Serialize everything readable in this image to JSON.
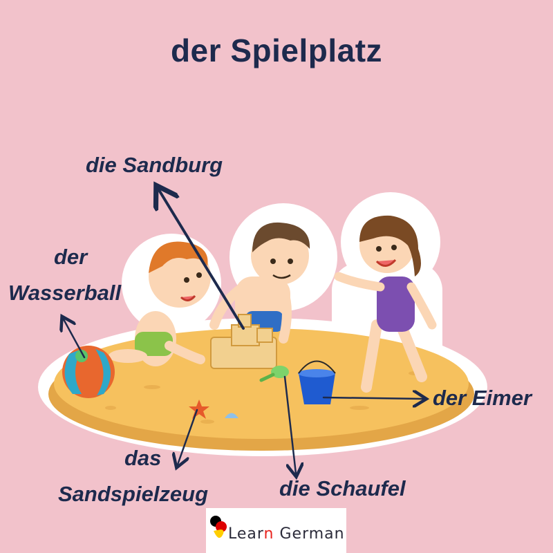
{
  "title": "der Spielplatz",
  "labels": {
    "sandburg": "die Sandburg",
    "wasserball_1": "der",
    "wasserball_2": "Wasserball",
    "eimer": "der Eimer",
    "sandspielzeug_1": "das",
    "sandspielzeug_2": "Sandspielzeug",
    "schaufel": "die Schaufel"
  },
  "logo": {
    "text_before": "Lear",
    "text_accent": "n",
    "text_after": " German",
    "flag_colors": [
      "#000000",
      "#dd0000",
      "#ffce00"
    ]
  },
  "colors": {
    "background": "#f2c2cb",
    "text": "#1d2a4d",
    "sand": "#f6c15e",
    "arrow": "#1d2a4d"
  }
}
